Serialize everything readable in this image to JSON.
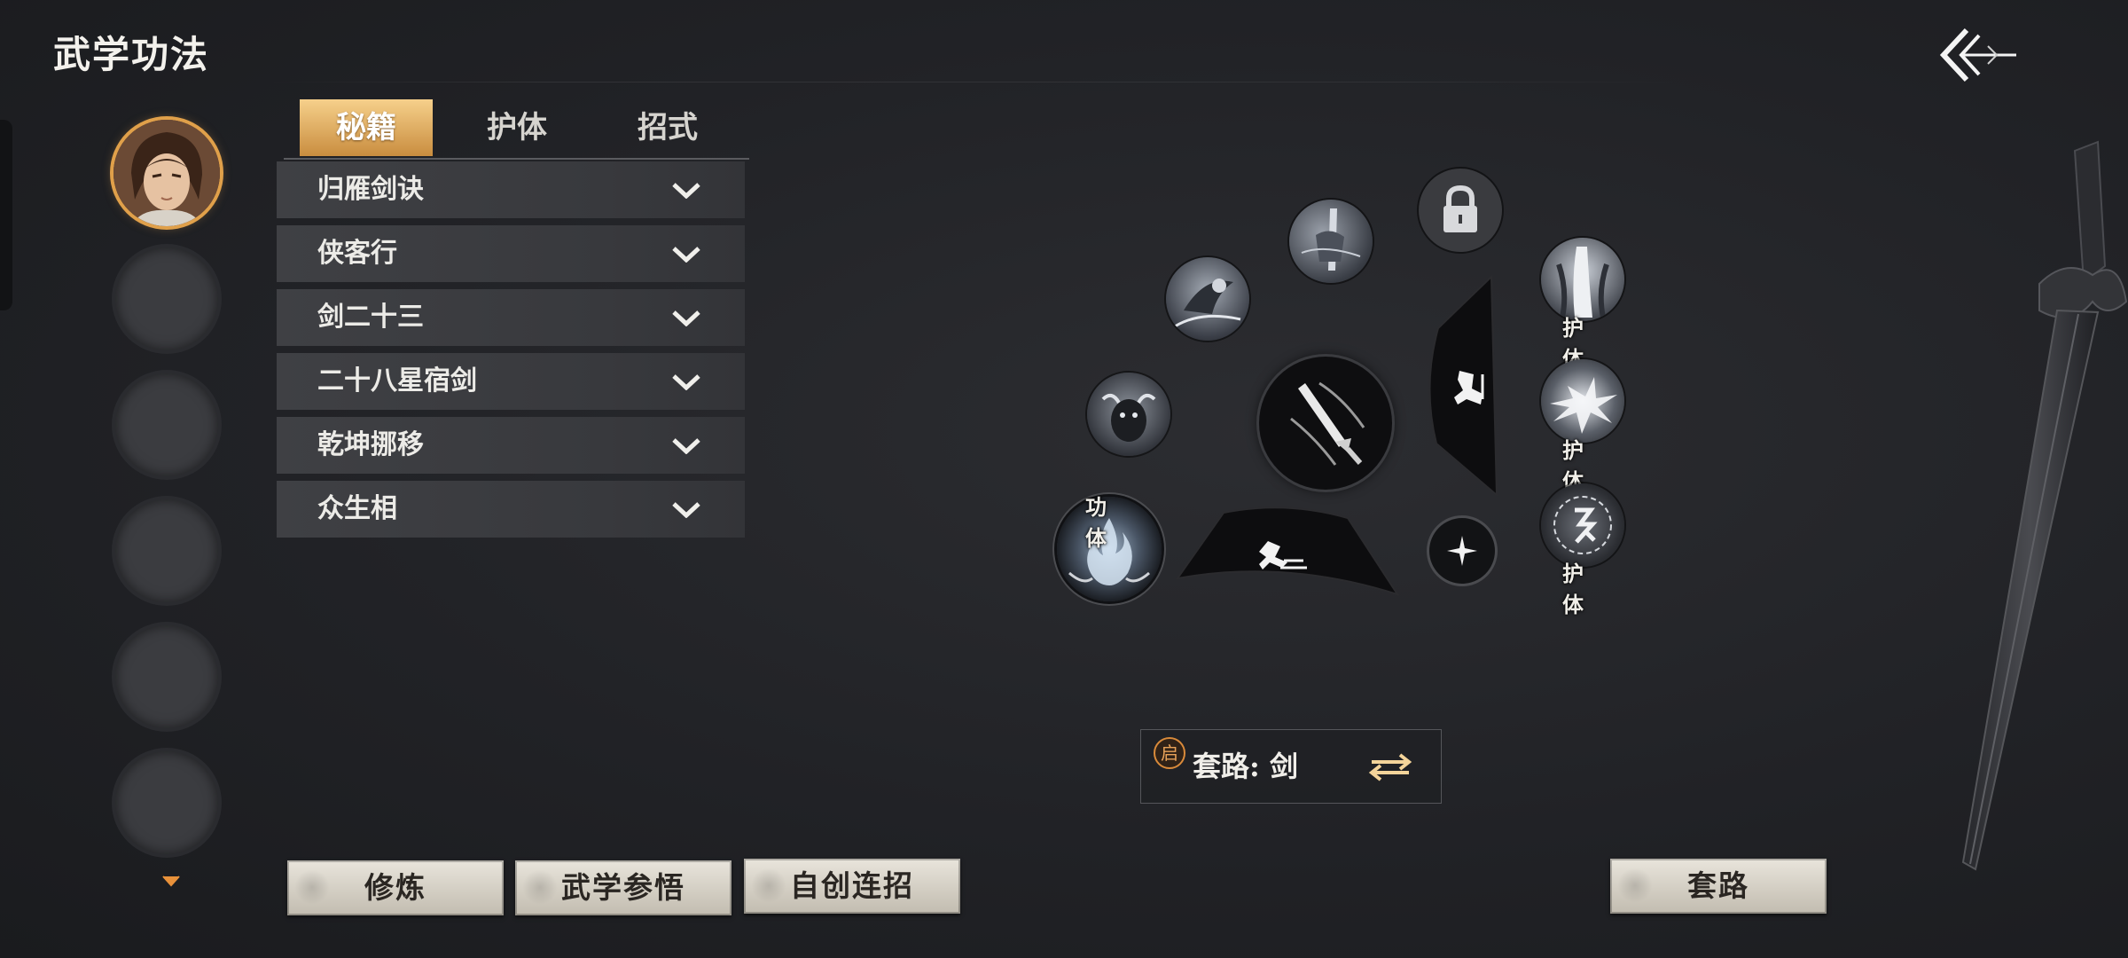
{
  "header": {
    "title": "武学功法",
    "back_icon": "back-arrow-icon"
  },
  "characters": {
    "active_index": 0,
    "slots": [
      "character",
      "empty",
      "empty",
      "empty",
      "empty",
      "empty"
    ],
    "scroll_icon": "chevron-down-icon"
  },
  "tabs": [
    {
      "label": "秘籍",
      "active": true
    },
    {
      "label": "护体",
      "active": false
    },
    {
      "label": "招式",
      "active": false
    }
  ],
  "skill_list": [
    {
      "label": "归雁剑诀"
    },
    {
      "label": "侠客行"
    },
    {
      "label": "剑二十三"
    },
    {
      "label": "二十八星宿剑"
    },
    {
      "label": "乾坤挪移"
    },
    {
      "label": "众生相"
    }
  ],
  "wheel": {
    "center_icon": "sword-slash-icon",
    "lock_icon": "lock-icon",
    "dodge_icon": "dash-icon",
    "jump_icon": "kick-icon",
    "target_icon": "crosshair-icon",
    "gongti_label": "功体",
    "huti_labels": [
      "护体",
      "护体",
      "护体"
    ]
  },
  "route": {
    "badge": "启",
    "label": "套路: 剑",
    "swap_icon": "swap-arrows-icon"
  },
  "buttons": {
    "practice": "修炼",
    "enlighten": "武学参悟",
    "custom_combo": "自创连招",
    "routine": "套路"
  },
  "colors": {
    "accent_gold": "#e0a04a",
    "tab_active_top": "#f6d08b",
    "tab_active_bottom": "#c98d3f",
    "background": "#212226"
  }
}
